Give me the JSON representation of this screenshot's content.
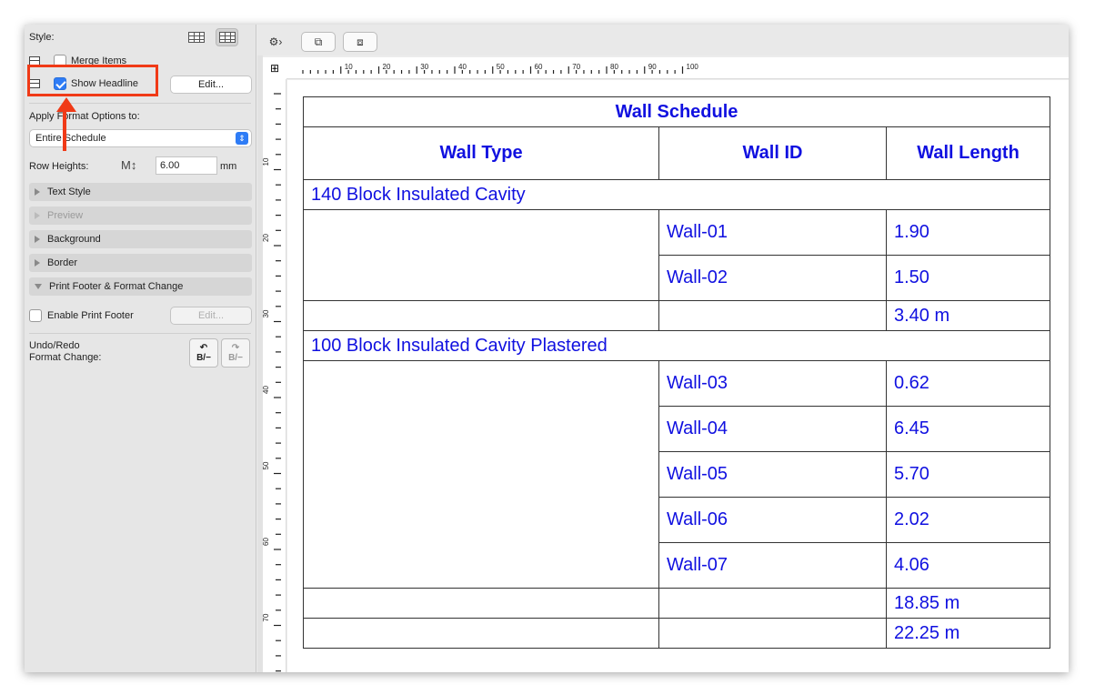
{
  "sidebar": {
    "style_label": "Style:",
    "merge_items_label": "Merge Items",
    "show_headline_label": "Show Headline",
    "show_headline_checked": true,
    "edit_label": "Edit...",
    "apply_format_label": "Apply Format Options to:",
    "apply_format_value": "Entire Schedule",
    "row_heights_label": "Row Heights:",
    "row_heights_value": "6.00",
    "row_heights_unit": "mm",
    "sections": [
      {
        "label": "Text Style",
        "expanded": false,
        "enabled": true
      },
      {
        "label": "Preview",
        "expanded": false,
        "enabled": false
      },
      {
        "label": "Background",
        "expanded": false,
        "enabled": true
      },
      {
        "label": "Border",
        "expanded": false,
        "enabled": true
      },
      {
        "label": "Print Footer & Format Change",
        "expanded": true,
        "enabled": true
      }
    ],
    "enable_print_footer_label": "Enable Print Footer",
    "print_footer_edit_label": "Edit...",
    "undo_redo_label_1": "Undo/Redo",
    "undo_redo_label_2": "Format Change:",
    "undo_glyph": "B/−",
    "redo_glyph": "B/−"
  },
  "rulers": {
    "horizontal_ticks": [
      "10",
      "20",
      "30",
      "40",
      "50",
      "60",
      "70",
      "80",
      "90",
      "100"
    ],
    "vertical_ticks": [
      "10",
      "20",
      "30",
      "40",
      "50",
      "60",
      "70"
    ]
  },
  "schedule": {
    "title": "Wall Schedule",
    "headers": [
      "Wall Type",
      "Wall ID",
      "Wall Length"
    ],
    "groups": [
      {
        "name": "140 Block Insulated Cavity",
        "rows": [
          {
            "id": "Wall-01",
            "length": "1.90"
          },
          {
            "id": "Wall-02",
            "length": "1.50"
          }
        ],
        "subtotal": "3.40 m"
      },
      {
        "name": "100 Block Insulated Cavity Plastered",
        "rows": [
          {
            "id": "Wall-03",
            "length": "0.62"
          },
          {
            "id": "Wall-04",
            "length": "6.45"
          },
          {
            "id": "Wall-05",
            "length": "5.70"
          },
          {
            "id": "Wall-06",
            "length": "2.02"
          },
          {
            "id": "Wall-07",
            "length": "4.06"
          }
        ],
        "subtotal": "18.85 m"
      }
    ],
    "grand_total": "22.25 m"
  },
  "colors": {
    "schedule_text": "#1010e0",
    "highlight": "#f03a17",
    "checkbox_accent": "#2e7cf6"
  }
}
